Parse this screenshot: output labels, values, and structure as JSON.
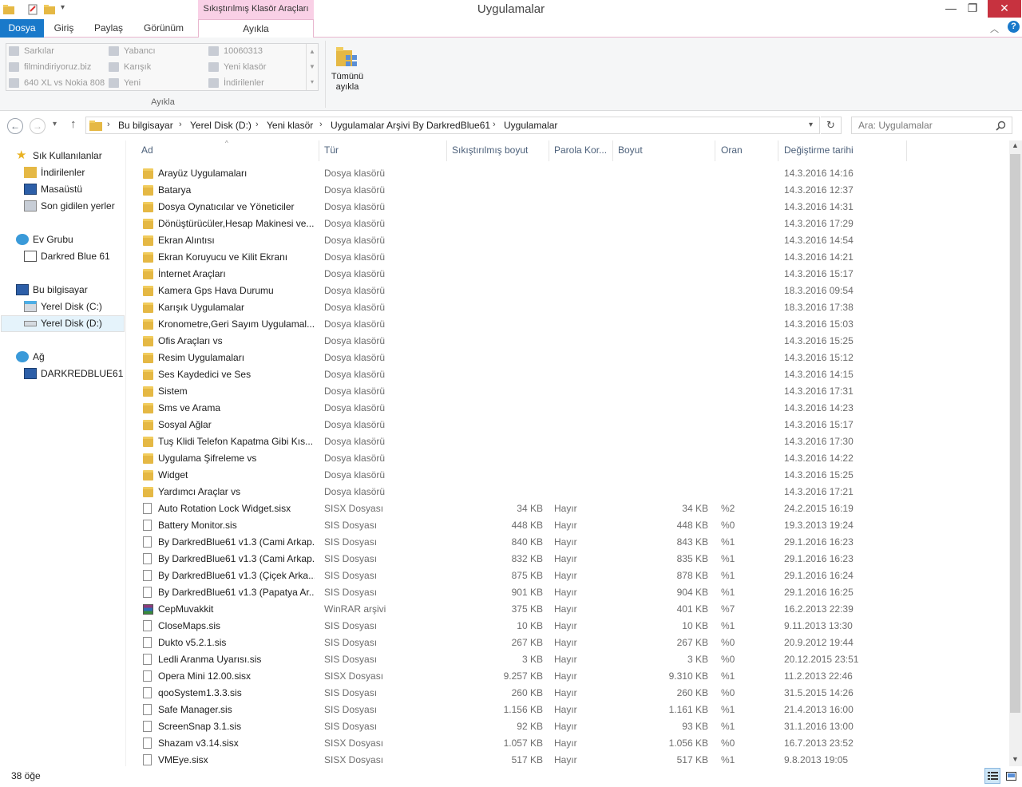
{
  "window": {
    "title": "Uygulamalar",
    "context_tab": "Sıkıştırılmış Klasör Araçları",
    "minimize": "—",
    "maximize": "❐",
    "close": "✕",
    "help": "?"
  },
  "ribbon": {
    "tabs": [
      "Dosya",
      "Giriş",
      "Paylaş",
      "Görünüm",
      "Ayıkla"
    ],
    "gallery": [
      "Sarkılar",
      "Yabancı",
      "10060313",
      "filmindiriyoruz.biz",
      "Karışık",
      "Yeni klasör",
      "640 XL vs Nokia 808",
      "Yeni",
      "İndirilenler"
    ],
    "group_label": "Ayıkla",
    "extract_all_line1": "Tümünü",
    "extract_all_line2": "ayıkla"
  },
  "navigation": {
    "breadcrumbs": [
      "Bu bilgisayar",
      "Yerel Disk (D:)",
      "Yeni klasör",
      "Uygulamalar Arşivi By DarkredBlue61",
      "Uygulamalar"
    ],
    "search_placeholder": "Ara: Uygulamalar"
  },
  "sidebar": {
    "items": [
      {
        "label": "Sık Kullanılanlar",
        "icon": "star-icon"
      },
      {
        "label": "İndirilenler",
        "icon": "downloads-icon"
      },
      {
        "label": "Masaüstü",
        "icon": "desktop-icon"
      },
      {
        "label": "Son gidilen yerler",
        "icon": "recent-places-icon"
      },
      {
        "label": "Ev Grubu",
        "icon": "homegroup-icon"
      },
      {
        "label": "Darkred Blue 61",
        "icon": "user-icon"
      },
      {
        "label": "Bu bilgisayar",
        "icon": "computer-icon"
      },
      {
        "label": "Yerel Disk (C:)",
        "icon": "windows-drive-icon"
      },
      {
        "label": "Yerel Disk (D:)",
        "icon": "drive-icon"
      },
      {
        "label": "Ağ",
        "icon": "network-icon"
      },
      {
        "label": "DARKREDBLUE61",
        "icon": "network-computer-icon"
      }
    ]
  },
  "columns": [
    "Ad",
    "Tür",
    "Sıkıştırılmış boyut",
    "Parola Kor...",
    "Boyut",
    "Oran",
    "Değiştirme tarihi"
  ],
  "files": [
    {
      "name": "Arayüz Uygulamaları",
      "type": "Dosya klasörü",
      "comp": "",
      "pw": "",
      "size": "",
      "ratio": "",
      "date": "14.3.2016 14:16",
      "kind": "folder"
    },
    {
      "name": "Batarya",
      "type": "Dosya klasörü",
      "comp": "",
      "pw": "",
      "size": "",
      "ratio": "",
      "date": "14.3.2016 12:37",
      "kind": "folder"
    },
    {
      "name": "Dosya Oynatıcılar ve Yöneticiler",
      "type": "Dosya klasörü",
      "comp": "",
      "pw": "",
      "size": "",
      "ratio": "",
      "date": "14.3.2016 14:31",
      "kind": "folder"
    },
    {
      "name": "Dönüştürücüler,Hesap Makinesi ve...",
      "type": "Dosya klasörü",
      "comp": "",
      "pw": "",
      "size": "",
      "ratio": "",
      "date": "14.3.2016 17:29",
      "kind": "folder"
    },
    {
      "name": "Ekran Alıntısı",
      "type": "Dosya klasörü",
      "comp": "",
      "pw": "",
      "size": "",
      "ratio": "",
      "date": "14.3.2016 14:54",
      "kind": "folder"
    },
    {
      "name": "Ekran Koruyucu ve Kilit Ekranı",
      "type": "Dosya klasörü",
      "comp": "",
      "pw": "",
      "size": "",
      "ratio": "",
      "date": "14.3.2016 14:21",
      "kind": "folder"
    },
    {
      "name": "İnternet Araçları",
      "type": "Dosya klasörü",
      "comp": "",
      "pw": "",
      "size": "",
      "ratio": "",
      "date": "14.3.2016 15:17",
      "kind": "folder"
    },
    {
      "name": "Kamera Gps Hava Durumu",
      "type": "Dosya klasörü",
      "comp": "",
      "pw": "",
      "size": "",
      "ratio": "",
      "date": "18.3.2016 09:54",
      "kind": "folder"
    },
    {
      "name": "Karışık Uygulamalar",
      "type": "Dosya klasörü",
      "comp": "",
      "pw": "",
      "size": "",
      "ratio": "",
      "date": "18.3.2016 17:38",
      "kind": "folder"
    },
    {
      "name": "Kronometre,Geri Sayım Uygulamal...",
      "type": "Dosya klasörü",
      "comp": "",
      "pw": "",
      "size": "",
      "ratio": "",
      "date": "14.3.2016 15:03",
      "kind": "folder"
    },
    {
      "name": "Ofis Araçları vs",
      "type": "Dosya klasörü",
      "comp": "",
      "pw": "",
      "size": "",
      "ratio": "",
      "date": "14.3.2016 15:25",
      "kind": "folder"
    },
    {
      "name": "Resim Uygulamaları",
      "type": "Dosya klasörü",
      "comp": "",
      "pw": "",
      "size": "",
      "ratio": "",
      "date": "14.3.2016 15:12",
      "kind": "folder"
    },
    {
      "name": "Ses Kaydedici ve Ses",
      "type": "Dosya klasörü",
      "comp": "",
      "pw": "",
      "size": "",
      "ratio": "",
      "date": "14.3.2016 14:15",
      "kind": "folder"
    },
    {
      "name": "Sistem",
      "type": "Dosya klasörü",
      "comp": "",
      "pw": "",
      "size": "",
      "ratio": "",
      "date": "14.3.2016 17:31",
      "kind": "folder"
    },
    {
      "name": "Sms ve Arama",
      "type": "Dosya klasörü",
      "comp": "",
      "pw": "",
      "size": "",
      "ratio": "",
      "date": "14.3.2016 14:23",
      "kind": "folder"
    },
    {
      "name": "Sosyal Ağlar",
      "type": "Dosya klasörü",
      "comp": "",
      "pw": "",
      "size": "",
      "ratio": "",
      "date": "14.3.2016 15:17",
      "kind": "folder"
    },
    {
      "name": "Tuş Klidi Telefon Kapatma Gibi Kıs...",
      "type": "Dosya klasörü",
      "comp": "",
      "pw": "",
      "size": "",
      "ratio": "",
      "date": "14.3.2016 17:30",
      "kind": "folder"
    },
    {
      "name": "Uygulama Şifreleme vs",
      "type": "Dosya klasörü",
      "comp": "",
      "pw": "",
      "size": "",
      "ratio": "",
      "date": "14.3.2016 14:22",
      "kind": "folder"
    },
    {
      "name": "Widget",
      "type": "Dosya klasörü",
      "comp": "",
      "pw": "",
      "size": "",
      "ratio": "",
      "date": "14.3.2016 15:25",
      "kind": "folder"
    },
    {
      "name": "Yardımcı Araçlar vs",
      "type": "Dosya klasörü",
      "comp": "",
      "pw": "",
      "size": "",
      "ratio": "",
      "date": "14.3.2016 17:21",
      "kind": "folder"
    },
    {
      "name": "Auto Rotation Lock Widget.sisx",
      "type": "SISX Dosyası",
      "comp": "34 KB",
      "pw": "Hayır",
      "size": "34 KB",
      "ratio": "%2",
      "date": "24.2.2015 16:19",
      "kind": "file"
    },
    {
      "name": "Battery Monitor.sis",
      "type": "SIS Dosyası",
      "comp": "448 KB",
      "pw": "Hayır",
      "size": "448 KB",
      "ratio": "%0",
      "date": "19.3.2013 19:24",
      "kind": "file"
    },
    {
      "name": "By DarkredBlue61 v1.3 (Cami Arkap...",
      "type": "SIS Dosyası",
      "comp": "840 KB",
      "pw": "Hayır",
      "size": "843 KB",
      "ratio": "%1",
      "date": "29.1.2016 16:23",
      "kind": "file"
    },
    {
      "name": "By DarkredBlue61 v1.3 (Cami Arkap...",
      "type": "SIS Dosyası",
      "comp": "832 KB",
      "pw": "Hayır",
      "size": "835 KB",
      "ratio": "%1",
      "date": "29.1.2016 16:23",
      "kind": "file"
    },
    {
      "name": "By DarkredBlue61 v1.3 (Çiçek Arka...",
      "type": "SIS Dosyası",
      "comp": "875 KB",
      "pw": "Hayır",
      "size": "878 KB",
      "ratio": "%1",
      "date": "29.1.2016 16:24",
      "kind": "file"
    },
    {
      "name": "By DarkredBlue61 v1.3 (Papatya Ar...",
      "type": "SIS Dosyası",
      "comp": "901 KB",
      "pw": "Hayır",
      "size": "904 KB",
      "ratio": "%1",
      "date": "29.1.2016 16:25",
      "kind": "file"
    },
    {
      "name": "CepMuvakkit",
      "type": "WinRAR arşivi",
      "comp": "375 KB",
      "pw": "Hayır",
      "size": "401 KB",
      "ratio": "%7",
      "date": "16.2.2013 22:39",
      "kind": "rar"
    },
    {
      "name": "CloseMaps.sis",
      "type": "SIS Dosyası",
      "comp": "10 KB",
      "pw": "Hayır",
      "size": "10 KB",
      "ratio": "%1",
      "date": "9.11.2013 13:30",
      "kind": "file"
    },
    {
      "name": "Dukto v5.2.1.sis",
      "type": "SIS Dosyası",
      "comp": "267 KB",
      "pw": "Hayır",
      "size": "267 KB",
      "ratio": "%0",
      "date": "20.9.2012 19:44",
      "kind": "file"
    },
    {
      "name": "Ledli Aranma Uyarısı.sis",
      "type": "SIS Dosyası",
      "comp": "3 KB",
      "pw": "Hayır",
      "size": "3 KB",
      "ratio": "%0",
      "date": "20.12.2015 23:51",
      "kind": "file"
    },
    {
      "name": "Opera Mini 12.00.sisx",
      "type": "SISX Dosyası",
      "comp": "9.257 KB",
      "pw": "Hayır",
      "size": "9.310 KB",
      "ratio": "%1",
      "date": "11.2.2013 22:46",
      "kind": "file"
    },
    {
      "name": "qooSystem1.3.3.sis",
      "type": "SIS Dosyası",
      "comp": "260 KB",
      "pw": "Hayır",
      "size": "260 KB",
      "ratio": "%0",
      "date": "31.5.2015 14:26",
      "kind": "file"
    },
    {
      "name": "Safe Manager.sis",
      "type": "SIS Dosyası",
      "comp": "1.156 KB",
      "pw": "Hayır",
      "size": "1.161 KB",
      "ratio": "%1",
      "date": "21.4.2013 16:00",
      "kind": "file"
    },
    {
      "name": "ScreenSnap 3.1.sis",
      "type": "SIS Dosyası",
      "comp": "92 KB",
      "pw": "Hayır",
      "size": "93 KB",
      "ratio": "%1",
      "date": "31.1.2016 13:00",
      "kind": "file"
    },
    {
      "name": "Shazam v3.14.sisx",
      "type": "SISX Dosyası",
      "comp": "1.057 KB",
      "pw": "Hayır",
      "size": "1.056 KB",
      "ratio": "%0",
      "date": "16.7.2013 23:52",
      "kind": "file"
    },
    {
      "name": "VMEye.sisx",
      "type": "SISX Dosyası",
      "comp": "517 KB",
      "pw": "Hayır",
      "size": "517 KB",
      "ratio": "%1",
      "date": "9.8.2013 19:05",
      "kind": "file"
    }
  ],
  "status": {
    "item_count": "38 öğe"
  },
  "colors": {
    "file_tab": "#1979ca",
    "context_tab": "#f9d0e6",
    "close_button": "#c7323f",
    "folder": "#e5b844"
  }
}
